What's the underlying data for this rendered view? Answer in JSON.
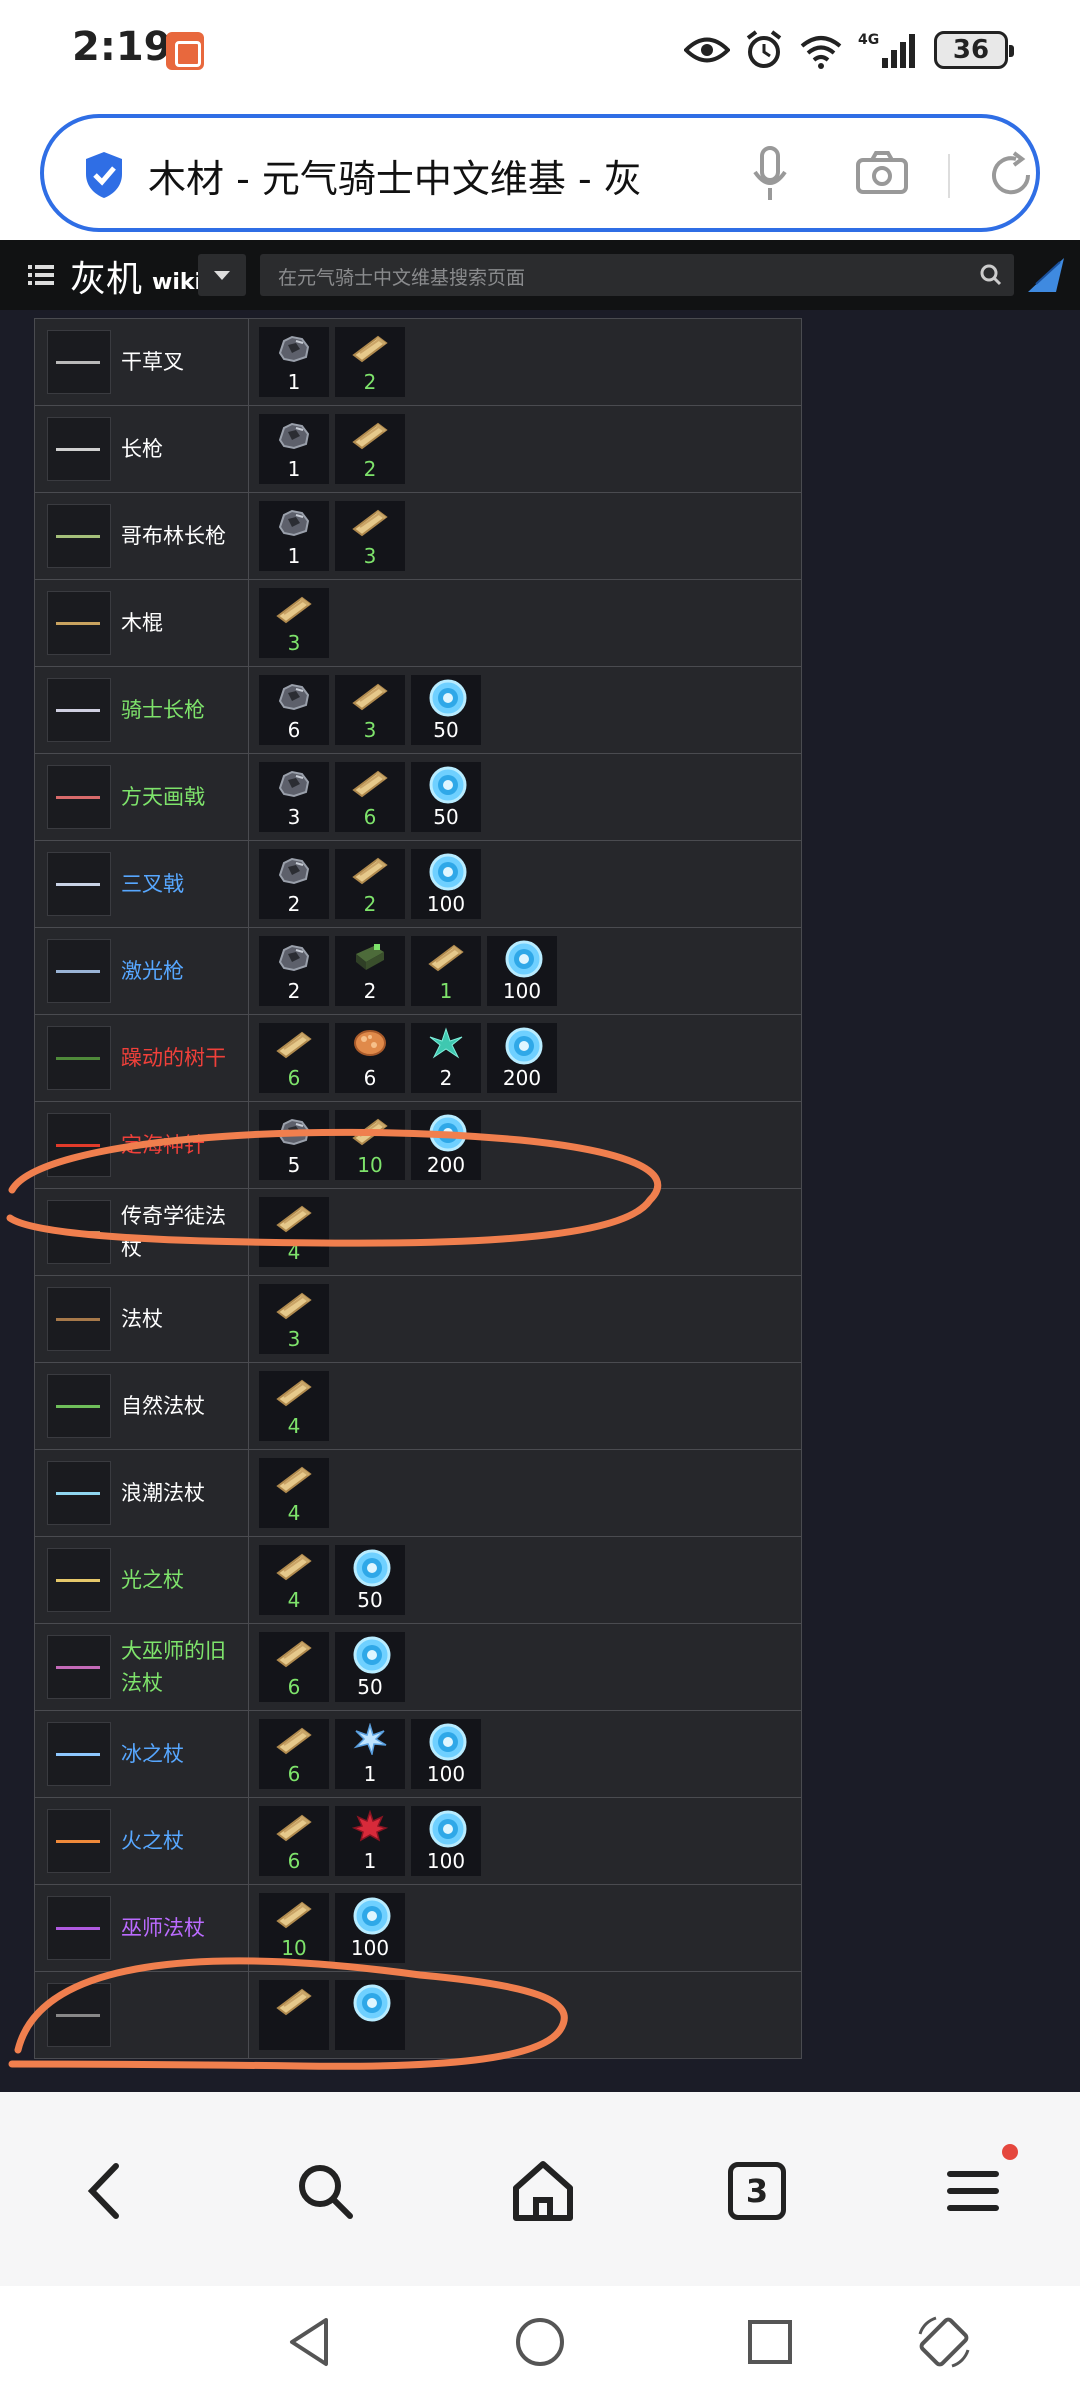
{
  "status_bar": {
    "time": "2:19",
    "battery": "36",
    "network": "4G"
  },
  "browser": {
    "url_title": "木材 - 元气骑士中文维基 - 灰",
    "tab_count": "3"
  },
  "wiki": {
    "logo_text": "灰机",
    "logo_sub": "wiki",
    "search_placeholder": "在元气骑士中文维基搜索页面"
  },
  "colors": {
    "accent_blue": "#2f6ee5",
    "annotation_orange": "#f07f4e",
    "quality_green": "#7ee36b",
    "quality_blue": "#57a7ff",
    "quality_red": "#f0403a",
    "quality_purple": "#bb6bff"
  },
  "rows": [
    {
      "name": "干草叉",
      "quality": "white",
      "weapon_color": "#b9b9b9",
      "mats": [
        {
          "icon": "ore-icon",
          "count": "1"
        },
        {
          "icon": "wood-icon",
          "count": "2"
        }
      ]
    },
    {
      "name": "长枪",
      "quality": "white",
      "weapon_color": "#d0d0d0",
      "mats": [
        {
          "icon": "ore-icon",
          "count": "1"
        },
        {
          "icon": "wood-icon",
          "count": "2"
        }
      ]
    },
    {
      "name": "哥布林长枪",
      "quality": "white",
      "weapon_color": "#a5c07a",
      "mats": [
        {
          "icon": "ore-icon",
          "count": "1"
        },
        {
          "icon": "wood-icon",
          "count": "3"
        }
      ]
    },
    {
      "name": "木棍",
      "quality": "white",
      "weapon_color": "#c9a35f",
      "mats": [
        {
          "icon": "wood-icon",
          "count": "3"
        }
      ]
    },
    {
      "name": "骑士长枪",
      "quality": "green",
      "weapon_color": "#cfcfe0",
      "mats": [
        {
          "icon": "ore-icon",
          "count": "6"
        },
        {
          "icon": "wood-icon",
          "count": "3"
        },
        {
          "icon": "gem-icon",
          "count": "50"
        }
      ]
    },
    {
      "name": "方天画戟",
      "quality": "green",
      "weapon_color": "#d86a6a",
      "mats": [
        {
          "icon": "ore-icon",
          "count": "3"
        },
        {
          "icon": "wood-icon",
          "count": "6"
        },
        {
          "icon": "gem-icon",
          "count": "50"
        }
      ]
    },
    {
      "name": "三叉戟",
      "quality": "blue",
      "weapon_color": "#c9d3e6",
      "mats": [
        {
          "icon": "ore-icon",
          "count": "2"
        },
        {
          "icon": "wood-icon",
          "count": "2"
        },
        {
          "icon": "gem-icon",
          "count": "100"
        }
      ]
    },
    {
      "name": "激光枪",
      "quality": "blue",
      "weapon_color": "#9ab4d6",
      "mats": [
        {
          "icon": "ore-icon",
          "count": "2"
        },
        {
          "icon": "battery-icon",
          "count": "2"
        },
        {
          "icon": "wood-icon",
          "count": "1"
        },
        {
          "icon": "gem-icon",
          "count": "100"
        }
      ]
    },
    {
      "name": "躁动的树干",
      "quality": "red",
      "weapon_color": "#4f8a3a",
      "mats": [
        {
          "icon": "wood-icon",
          "count": "6"
        },
        {
          "icon": "meat-icon",
          "count": "6"
        },
        {
          "icon": "crystal-icon",
          "count": "2"
        },
        {
          "icon": "gem-icon",
          "count": "200"
        }
      ]
    },
    {
      "name": "定海神针",
      "quality": "red",
      "weapon_color": "#e23b2a",
      "mats": [
        {
          "icon": "ore-icon",
          "count": "5"
        },
        {
          "icon": "wood-icon",
          "count": "10"
        },
        {
          "icon": "gem-icon",
          "count": "200"
        }
      ]
    },
    {
      "name": "传奇学徒法杖",
      "quality": "white",
      "weapon_color": "#b08a5a",
      "mats": [
        {
          "icon": "wood-icon",
          "count": "4"
        }
      ]
    },
    {
      "name": "法杖",
      "quality": "white",
      "weapon_color": "#a7794a",
      "mats": [
        {
          "icon": "wood-icon",
          "count": "3"
        }
      ]
    },
    {
      "name": "自然法杖",
      "quality": "white",
      "weapon_color": "#6fbf5a",
      "mats": [
        {
          "icon": "wood-icon",
          "count": "4"
        }
      ]
    },
    {
      "name": "浪潮法杖",
      "quality": "white",
      "weapon_color": "#8fd6f0",
      "mats": [
        {
          "icon": "wood-icon",
          "count": "4"
        }
      ]
    },
    {
      "name": "光之杖",
      "quality": "green",
      "weapon_color": "#e6c86a",
      "mats": [
        {
          "icon": "wood-icon",
          "count": "4"
        },
        {
          "icon": "gem-icon",
          "count": "50"
        }
      ]
    },
    {
      "name": "大巫师的旧法杖",
      "quality": "green",
      "weapon_color": "#c46ab8",
      "mats": [
        {
          "icon": "wood-icon",
          "count": "6"
        },
        {
          "icon": "gem-icon",
          "count": "50"
        }
      ]
    },
    {
      "name": "冰之杖",
      "quality": "blue",
      "weapon_color": "#8ec8ff",
      "mats": [
        {
          "icon": "wood-icon",
          "count": "6"
        },
        {
          "icon": "ice-icon",
          "count": "1"
        },
        {
          "icon": "gem-icon",
          "count": "100"
        }
      ]
    },
    {
      "name": "火之杖",
      "quality": "blue",
      "weapon_color": "#f08a3a",
      "mats": [
        {
          "icon": "wood-icon",
          "count": "6"
        },
        {
          "icon": "maple-leaf-icon",
          "count": "1"
        },
        {
          "icon": "gem-icon",
          "count": "100"
        }
      ]
    },
    {
      "name": "巫师法杖",
      "quality": "purple",
      "weapon_color": "#b05ae0",
      "mats": [
        {
          "icon": "wood-icon",
          "count": "10"
        },
        {
          "icon": "gem-icon",
          "count": "100"
        }
      ]
    },
    {
      "name": "",
      "quality": "white",
      "weapon_color": "#888888",
      "mats": [
        {
          "icon": "wood-icon",
          "count": ""
        },
        {
          "icon": "gem-icon",
          "count": ""
        }
      ]
    }
  ]
}
